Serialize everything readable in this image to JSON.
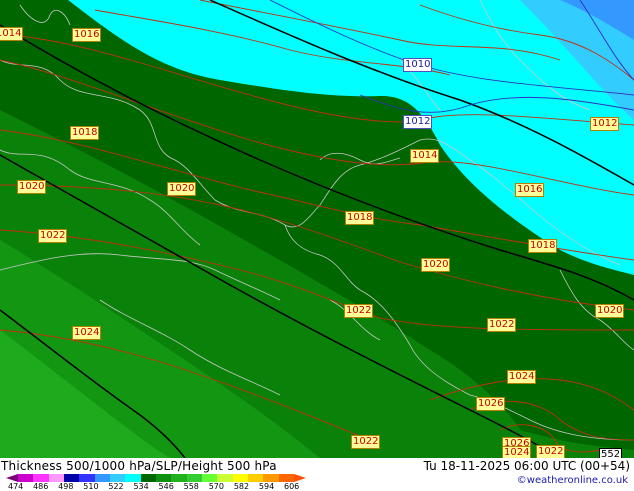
{
  "title": "Thickness 500/1000 hPa/SLP/Height 500 hPa",
  "valid_time": "Tu 18-11-2025 06:00 UTC (00+54)",
  "credit": "©weatheronline.co.uk",
  "colors": {
    "thickness_534": "#006600",
    "thickness_540": "#0a820a",
    "thickness_546": "#139713",
    "thickness_552": "#1dab1d",
    "thickness_528": "#00ffff",
    "thickness_522": "#33ccff",
    "isobar": "#c03010",
    "height_contour": "#000000",
    "coastline": "#c8c8c8"
  },
  "legend": {
    "ticks": [
      "474",
      "486",
      "498",
      "510",
      "522",
      "534",
      "546",
      "558",
      "570",
      "582",
      "594",
      "606"
    ],
    "segments": [
      "#cc00cc",
      "#ff33ff",
      "#ff99ff",
      "#0000aa",
      "#3333ff",
      "#3399ff",
      "#33ccff",
      "#00ffff",
      "#006600",
      "#109010",
      "#20b020",
      "#33cc33",
      "#66ff33",
      "#ccff33",
      "#ffff00",
      "#ffcc00",
      "#ff9900",
      "#ff6600"
    ]
  },
  "isobar_labels": [
    {
      "text": "1014",
      "kind": "high"
    },
    {
      "text": "1016",
      "kind": "high"
    },
    {
      "text": "1010",
      "kind": "low"
    },
    {
      "text": "1012",
      "kind": "low"
    },
    {
      "text": "1012",
      "kind": "high"
    },
    {
      "text": "1018",
      "kind": "high"
    },
    {
      "text": "1014",
      "kind": "high"
    },
    {
      "text": "1020",
      "kind": "high"
    },
    {
      "text": "1020",
      "kind": "high"
    },
    {
      "text": "1016",
      "kind": "high"
    },
    {
      "text": "1018",
      "kind": "high"
    },
    {
      "text": "1022",
      "kind": "high"
    },
    {
      "text": "1018",
      "kind": "high"
    },
    {
      "text": "1020",
      "kind": "high"
    },
    {
      "text": "1022",
      "kind": "high"
    },
    {
      "text": "1020",
      "kind": "high"
    },
    {
      "text": "1024",
      "kind": "high"
    },
    {
      "text": "1022",
      "kind": "high"
    },
    {
      "text": "1024",
      "kind": "high"
    },
    {
      "text": "1026",
      "kind": "high"
    },
    {
      "text": "1022",
      "kind": "high"
    },
    {
      "text": "1026",
      "kind": "high"
    },
    {
      "text": "1024",
      "kind": "high"
    },
    {
      "text": "1022",
      "kind": "high"
    },
    {
      "text": "552",
      "kind": "high"
    }
  ]
}
